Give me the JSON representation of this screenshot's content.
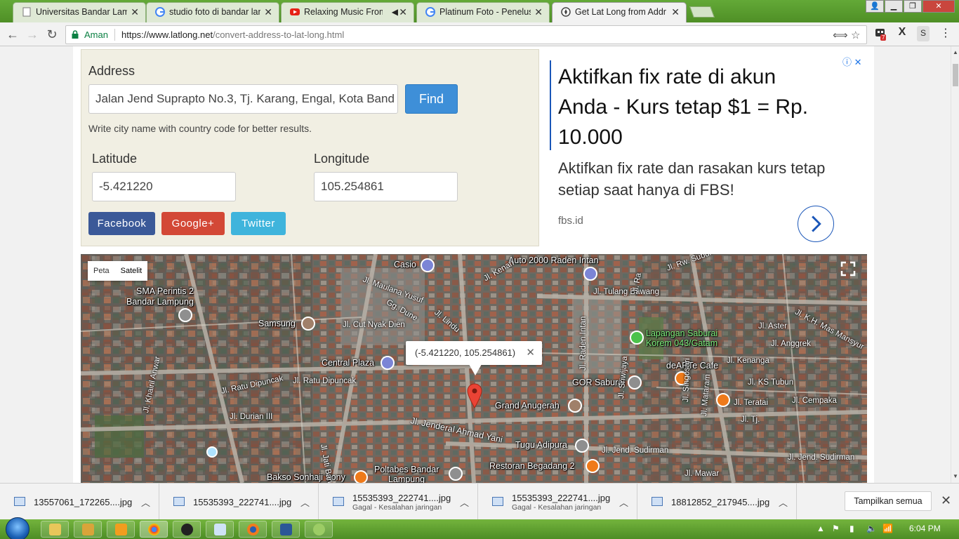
{
  "browser": {
    "tabs": [
      {
        "label": "Universitas Bandar Lamp",
        "favicon": "document-icon"
      },
      {
        "label": "studio foto di bandar lan",
        "favicon": "google-icon"
      },
      {
        "label": "Relaxing Music From",
        "favicon": "youtube-icon"
      },
      {
        "label": "Platinum Foto - Penelusu",
        "favicon": "google-icon"
      },
      {
        "label": "Get Lat Long from Addre",
        "favicon": "compass-icon"
      }
    ],
    "secure_label": "Aman",
    "url_host": "https://www.latlong.net",
    "url_path": "/convert-address-to-lat-long.html",
    "extension_badge": "7"
  },
  "form": {
    "address_label": "Address",
    "address_value": "Jalan Jend Suprapto No.3, Tj. Karang, Engal, Kota Band",
    "find_label": "Find",
    "hint": "Write city name with country code for better results.",
    "latitude_label": "Latitude",
    "latitude_value": "-5.421220",
    "longitude_label": "Longitude",
    "longitude_value": "105.254861",
    "share": {
      "facebook": "Facebook",
      "google": "Google+",
      "twitter": "Twitter"
    }
  },
  "ad": {
    "headline": "Aktifkan fix rate di akun Anda - Kurs tetap $1 = Rp. 10.000",
    "body": "Aktifkan fix rate dan rasakan kurs tetap setiap saat hanya di FBS!",
    "site": "fbs.id",
    "accent": "#1a56b8"
  },
  "map": {
    "type_map": "Peta",
    "type_satellite": "Satelit",
    "infowindow": "(-5.421220, 105.254861)",
    "places": [
      "Casio",
      "Auto 2000 Raden Intan",
      "SMA Perintis 2",
      "Bandar Lampung",
      "Samsung",
      "Central Plaza",
      "Lapangan Saburai",
      "Korem 043/Gatam",
      "deARTe Cafe",
      "GOR Saburai",
      "Grand Anugerah",
      "Tugu Adipura",
      "Restoran Begadang 2",
      "Bakso Sonhaji Sony",
      "Poltabes Bandar",
      "Lampung"
    ],
    "roads": [
      "Jl. Maulana Yusuf",
      "Jl. Kenari",
      "Jl. Tulang Bawang",
      "Gg. Dune",
      "Jl. Lindu",
      "Jl. Cut Nyak Dien",
      "Jl. Raden Intan",
      "Jl. Aster",
      "Jl. K.H. Mas Mansyur",
      "Jl. Anggrek",
      "Jl. Khairil Anwar",
      "Jl. Ratu Dipuncak",
      "Jl. Ratu Dipuncak",
      "Jl. Kenanga",
      "Jl. KS Tubun",
      "Jl. Durian III",
      "Jl. Jati Baru",
      "Jl. Jenderal Ahmad Yani",
      "Jl. Sriwijaya",
      "Jl. Singosari",
      "Jl. Mataram",
      "Jl. Teratai",
      "Jl. Cempaka",
      "Jl. Tj.",
      "Jl. Jend. Sudirman",
      "Jl. Jend. Sudirman",
      "Jl. Mawar",
      "Jl. Rw. Subur",
      "Jl. Ra"
    ]
  },
  "downloads": [
    {
      "name": "13557061_172265....jpg",
      "status": ""
    },
    {
      "name": "15535393_222741....jpg",
      "status": ""
    },
    {
      "name": "15535393_222741....jpg",
      "status": "Gagal - Kesalahan jaringan"
    },
    {
      "name": "15535393_222741....jpg",
      "status": "Gagal - Kesalahan jaringan"
    },
    {
      "name": "18812852_217945....jpg",
      "status": ""
    }
  ],
  "downloads_show_all": "Tampilkan semua",
  "taskbar": {
    "time": "6:04 PM"
  }
}
